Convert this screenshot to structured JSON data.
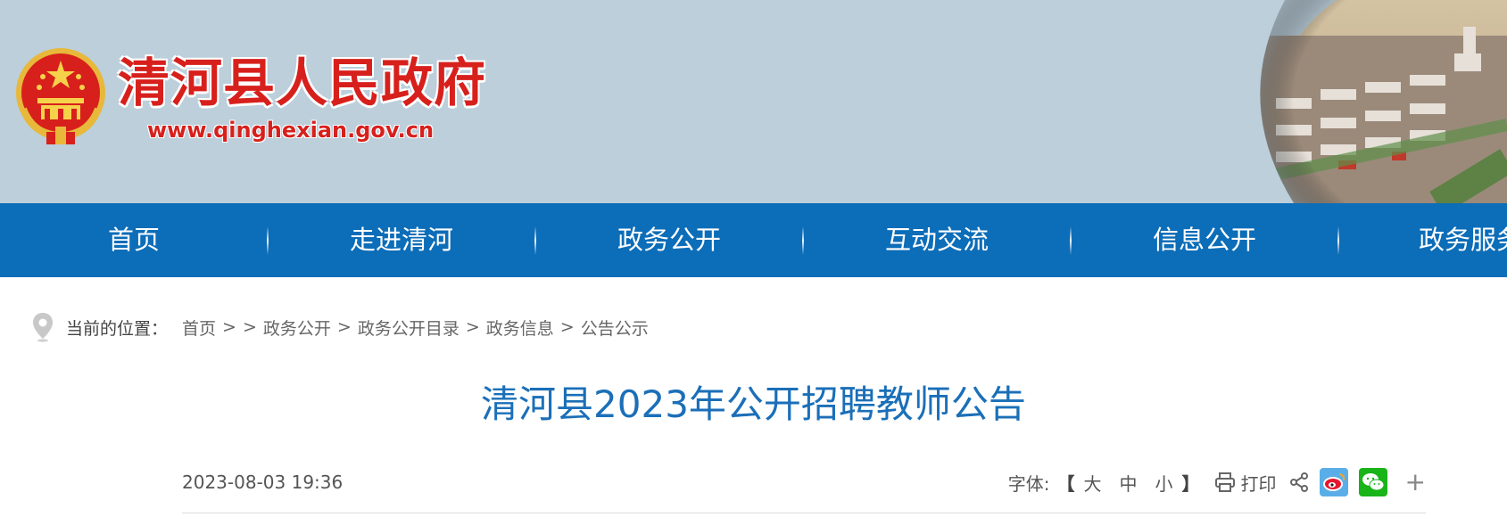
{
  "header": {
    "site_title": "清河县人民政府",
    "site_url": "www.qinghexian.gov.cn",
    "brand_color": "#d7201c",
    "banner_color": "#bccfdb"
  },
  "nav": {
    "color": "#0c6db8",
    "items": [
      {
        "label": "首页"
      },
      {
        "label": "走进清河"
      },
      {
        "label": "政务公开"
      },
      {
        "label": "互动交流"
      },
      {
        "label": "信息公开"
      },
      {
        "label": "政务服务"
      }
    ]
  },
  "breadcrumb": {
    "label": "当前的位置：",
    "items": [
      "首页",
      "",
      "政务公开",
      "政务公开目录",
      "政务信息",
      "公告公示"
    ],
    "separator": ">"
  },
  "article": {
    "title": "清河县2023年公开招聘教师公告",
    "title_color": "#1b6fb8",
    "date": "2023-08-03 19:36"
  },
  "tools": {
    "font_label": "字体:",
    "bracket_open": "【",
    "bracket_close": "】",
    "size_large": "大",
    "size_medium": "中",
    "size_small": "小",
    "print_label": "打印",
    "plus": "+",
    "icons": [
      "printer-icon",
      "share-icon",
      "weibo-icon",
      "wechat-icon"
    ]
  }
}
